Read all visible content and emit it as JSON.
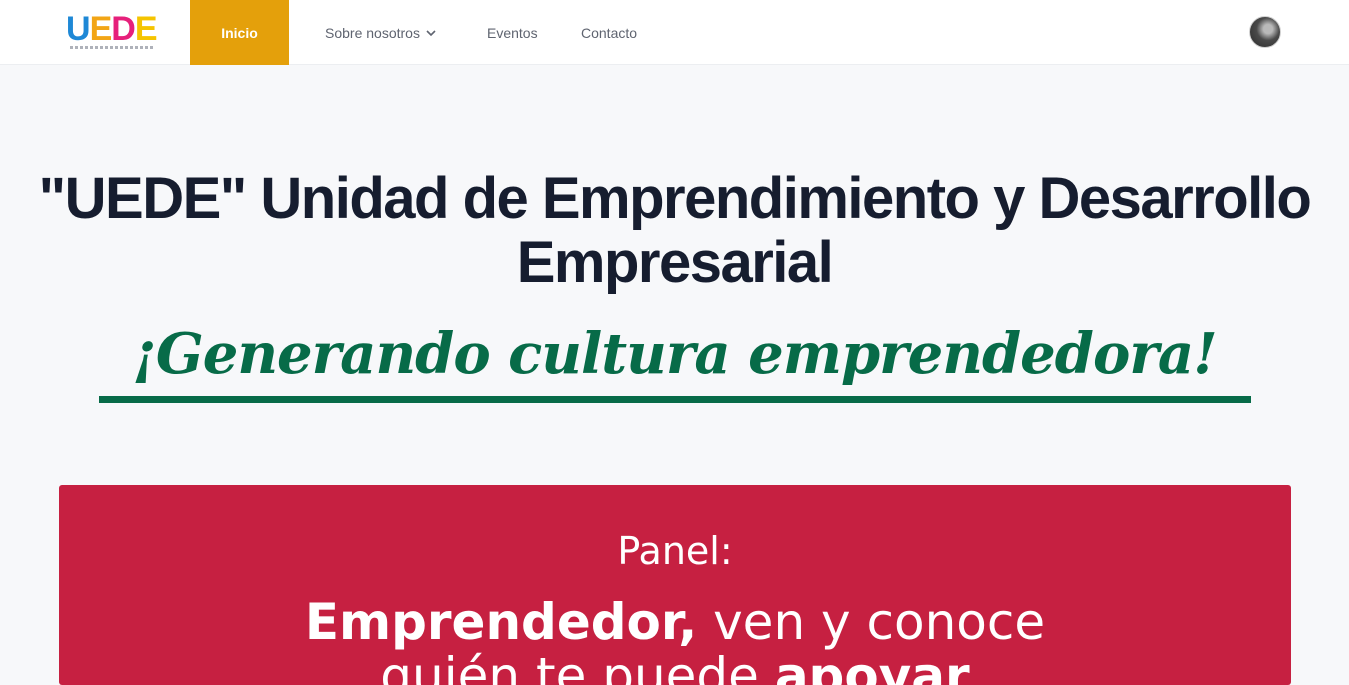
{
  "brand": {
    "logo_text": [
      "U",
      "E",
      "D",
      "E"
    ]
  },
  "nav": {
    "items": [
      {
        "label": "Inicio",
        "active": true
      },
      {
        "label": "Sobre nosotros",
        "dropdown": true
      },
      {
        "label": "Eventos"
      },
      {
        "label": "Contacto"
      }
    ],
    "accent_color": "#e4a00b"
  },
  "user": {
    "avatar": "user-avatar-photo"
  },
  "hero": {
    "title": "\"UEDE\" Unidad de Emprendimiento y Desarrollo Empresarial",
    "tagline": "¡Generando cultura emprendedora!",
    "title_color": "#161d2f",
    "tagline_color": "#076b48"
  },
  "banner": {
    "label": "Panel:",
    "line1_bold": "Emprendedor,",
    "line1_rest": " ven y conoce",
    "line2_rest": "quién te puede ",
    "line2_bold": "apoyar",
    "background": "#c62041"
  }
}
